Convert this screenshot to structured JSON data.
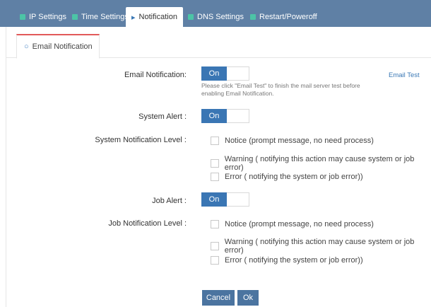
{
  "tabs": [
    {
      "label": "IP Settings",
      "icon": "network-icon"
    },
    {
      "label": "Time Settings",
      "icon": "clock-icon"
    },
    {
      "label": "Notification",
      "icon": "megaphone-icon"
    },
    {
      "label": "DNS Settings",
      "icon": "dns-icon"
    },
    {
      "label": "Restart/Poweroff",
      "icon": "power-icon"
    }
  ],
  "subtab": {
    "label": "Email Notification",
    "icon": "email-icon"
  },
  "email_notification": {
    "label": "Email Notification:",
    "toggle": "On",
    "hint": "Please click \"Email Test\" to finish the mail server test before enabling Email Notification.",
    "test_link": "Email Test"
  },
  "system_alert": {
    "label": "System Alert :",
    "toggle": "On"
  },
  "system_level": {
    "label": "System Notification Level :",
    "options": [
      "Notice (prompt message, no need process)",
      "Warning ( notifying this action may cause system or job error)",
      "Error ( notifying the system or job error))"
    ]
  },
  "job_alert": {
    "label": "Job Alert :",
    "toggle": "On"
  },
  "job_level": {
    "label": "Job Notification Level :",
    "options": [
      "Notice (prompt message, no need process)",
      "Warning ( notifying this action may cause system or job error)",
      "Error ( notifying the system or job error))"
    ]
  },
  "buttons": {
    "cancel": "Cancel",
    "ok": "Ok"
  },
  "colors": {
    "topbar": "#5f80a5",
    "accent": "#3a76b4",
    "tab_icon": "#4cc4a6",
    "active_border": "#e25a5a"
  }
}
